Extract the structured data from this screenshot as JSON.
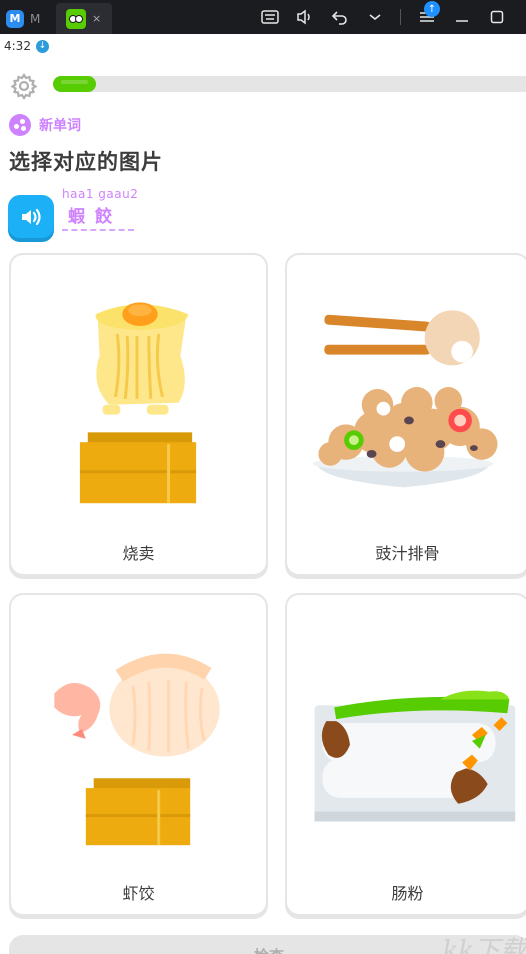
{
  "titlebar": {
    "tab1_label": "M",
    "tab2_close": "×"
  },
  "statusbar": {
    "time": "4:32"
  },
  "lesson": {
    "badge_label": "新单词",
    "prompt": "选择对应的图片",
    "romanization": "haa1 gaau2",
    "word": "蝦餃",
    "progress": 0.09
  },
  "choices": [
    {
      "label": "烧卖",
      "icon": "siu-mai-icon"
    },
    {
      "label": "豉汁排骨",
      "icon": "spare-ribs-icon"
    },
    {
      "label": "虾饺",
      "icon": "har-gow-icon"
    },
    {
      "label": "肠粉",
      "icon": "rice-noodle-roll-icon"
    }
  ],
  "footer": {
    "check_label": "检查",
    "watermark": "kk下载"
  },
  "colors": {
    "green": "#58cc02",
    "purple": "#ce82ff",
    "blue": "#1cb0f6"
  }
}
